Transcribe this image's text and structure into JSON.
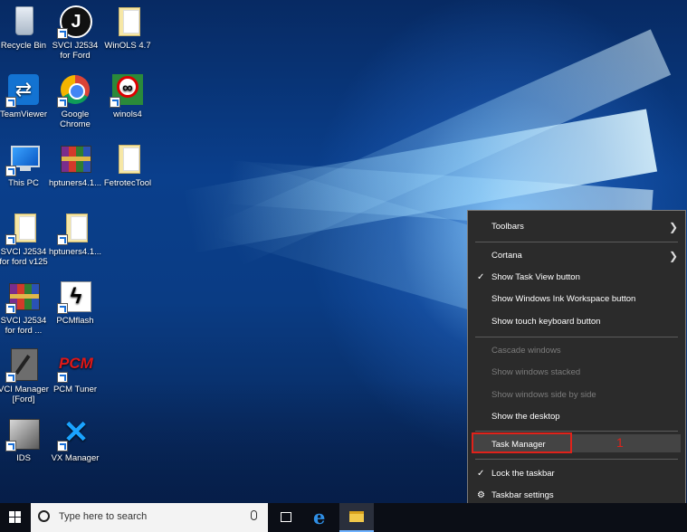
{
  "desktop_icons": [
    {
      "label": "Recycle Bin",
      "icon": "recycle-bin-icon"
    },
    {
      "label": "SVCI J2534 for Ford",
      "icon": "svci-j-icon"
    },
    {
      "label": "WinOLS 4.7",
      "icon": "folder-icon"
    },
    {
      "label": "TeamViewer",
      "icon": "teamviewer-icon"
    },
    {
      "label": "Google Chrome",
      "icon": "chrome-icon"
    },
    {
      "label": "winols4",
      "icon": "winols-icon"
    },
    {
      "label": "This PC",
      "icon": "this-pc-icon"
    },
    {
      "label": "hptuners4.1...",
      "icon": "winrar-icon"
    },
    {
      "label": "FetrotecTool",
      "icon": "folder-icon"
    },
    {
      "label": "SVCI J2534 for ford v125",
      "icon": "folder-icon"
    },
    {
      "label": "hptuners4.1...",
      "icon": "folder-icon"
    },
    {
      "label": "SVCI J2534 for ford ...",
      "icon": "winrar-icon"
    },
    {
      "label": "PCMflash",
      "icon": "pcmflash-icon"
    },
    {
      "label": "VCI Manager [Ford]",
      "icon": "vci-manager-icon"
    },
    {
      "label": "PCM Tuner",
      "icon": "pcm-tuner-icon"
    },
    {
      "label": "IDS",
      "icon": "ids-icon"
    },
    {
      "label": "VX Manager",
      "icon": "vx-manager-icon"
    }
  ],
  "context_menu": {
    "items": [
      {
        "label": "Toolbars",
        "submenu": true,
        "checked": false,
        "enabled": true
      },
      {
        "label": "Cortana",
        "submenu": true,
        "checked": false,
        "enabled": true
      },
      {
        "label": "Show Task View button",
        "submenu": false,
        "checked": true,
        "enabled": true
      },
      {
        "label": "Show Windows Ink Workspace button",
        "submenu": false,
        "checked": false,
        "enabled": true
      },
      {
        "label": "Show touch keyboard button",
        "submenu": false,
        "checked": false,
        "enabled": true
      },
      {
        "label": "Cascade windows",
        "submenu": false,
        "checked": false,
        "enabled": false
      },
      {
        "label": "Show windows stacked",
        "submenu": false,
        "checked": false,
        "enabled": false
      },
      {
        "label": "Show windows side by side",
        "submenu": false,
        "checked": false,
        "enabled": false
      },
      {
        "label": "Show the desktop",
        "submenu": false,
        "checked": false,
        "enabled": true
      },
      {
        "label": "Task Manager",
        "submenu": false,
        "checked": false,
        "enabled": true,
        "highlighted": true
      },
      {
        "label": "Lock the taskbar",
        "submenu": false,
        "checked": true,
        "enabled": true
      },
      {
        "label": "Taskbar settings",
        "submenu": false,
        "checked": false,
        "enabled": true,
        "icon": "gear-icon"
      }
    ],
    "annotation": "1",
    "highlight_color": "#e0221a"
  },
  "taskbar": {
    "search_placeholder": "Type here to search",
    "pinned": [
      {
        "name": "task-view-button",
        "icon": "task-view-icon"
      },
      {
        "name": "edge-button",
        "icon": "edge-icon"
      },
      {
        "name": "file-explorer-button",
        "icon": "folder-icon",
        "active": true
      }
    ]
  },
  "glyphs": {
    "check": "✓",
    "arrow": "❯",
    "gear": "⚙"
  }
}
